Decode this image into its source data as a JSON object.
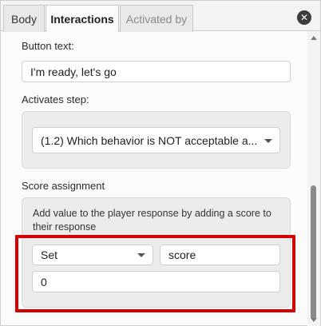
{
  "tabs": [
    {
      "label": "Body",
      "active": false
    },
    {
      "label": "Interactions",
      "active": true
    },
    {
      "label": "Activated by",
      "active": false,
      "disabled": true
    }
  ],
  "close_icon": "close-icon",
  "form": {
    "button_text_label": "Button text:",
    "button_text_value": "I'm ready, let's go",
    "activates_step_label": "Activates step:",
    "activates_step_value": "(1.2) Which behavior is NOT acceptable a...",
    "score_assignment_label": "Score assignment",
    "score_help": "Add value to the player response by adding a score to their response",
    "score_operation_value": "Set",
    "score_variable_value": "score",
    "score_amount_value": "0"
  },
  "colors": {
    "highlight": "#d40000",
    "active_tab_bg": "#fbfbfb",
    "group_bg": "#ececec"
  }
}
